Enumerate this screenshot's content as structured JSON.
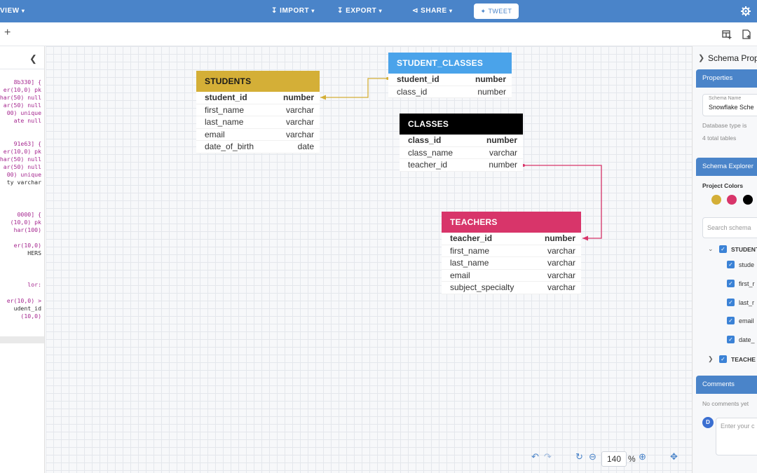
{
  "topbar": {
    "view_label": "VIEW",
    "import_label": "IMPORT",
    "export_label": "EXPORT",
    "share_label": "SHARE",
    "tweet_label": "TWEET",
    "accent": "#4a84c9"
  },
  "code_lines": [
    {
      "text": "8b330] {",
      "style": "pk"
    },
    {
      "text": "er(10,0) pk",
      "style": "pk"
    },
    {
      "text": "har(50) null",
      "style": "pk"
    },
    {
      "text": "ar(50) null",
      "style": "pk"
    },
    {
      "text": "00) unique",
      "style": "pk"
    },
    {
      "text": "ate null",
      "style": "pk"
    },
    {
      "text": "91e63] {",
      "style": "pk"
    },
    {
      "text": "er(10,0) pk",
      "style": "pk"
    },
    {
      "text": "har(50) null",
      "style": "pk"
    },
    {
      "text": "ar(50) null",
      "style": "pk"
    },
    {
      "text": "00) unique",
      "style": "pk"
    },
    {
      "text": "ty varchar",
      "style": "tx"
    },
    {
      "text": "0000] {",
      "style": "pk"
    },
    {
      "text": "(10,0) pk",
      "style": "pk"
    },
    {
      "text": "har(100)",
      "style": "pk"
    },
    {
      "text": "er(10,0)",
      "style": "pk"
    },
    {
      "text": "HERS",
      "style": "tx"
    },
    {
      "text": "lor:",
      "style": "pk"
    },
    {
      "text": "er(10,0) >",
      "style": "pk"
    },
    {
      "text": "udent_id",
      "style": "tx"
    },
    {
      "text": "(10,0)",
      "style": "pk"
    }
  ],
  "tables": {
    "students": {
      "name": "STUDENTS",
      "color": "#d4af37",
      "text_color": "#1a1a1a",
      "rows": [
        {
          "field": "student_id",
          "type": "number"
        },
        {
          "field": "first_name",
          "type": "varchar"
        },
        {
          "field": "last_name",
          "type": "varchar"
        },
        {
          "field": "email",
          "type": "varchar"
        },
        {
          "field": "date_of_birth",
          "type": "date"
        }
      ]
    },
    "student_classes": {
      "name": "STUDENT_CLASSES",
      "color": "#4aa3ea",
      "text_color": "#ffffff",
      "rows": [
        {
          "field": "student_id",
          "type": "number"
        },
        {
          "field": "class_id",
          "type": "number"
        }
      ]
    },
    "classes": {
      "name": "CLASSES",
      "color": "#000000",
      "text_color": "#ffffff",
      "rows": [
        {
          "field": "class_id",
          "type": "number"
        },
        {
          "field": "class_name",
          "type": "varchar"
        },
        {
          "field": "teacher_id",
          "type": "number"
        }
      ]
    },
    "teachers": {
      "name": "TEACHERS",
      "color": "#d8356a",
      "text_color": "#ffffff",
      "rows": [
        {
          "field": "teacher_id",
          "type": "number"
        },
        {
          "field": "first_name",
          "type": "varchar"
        },
        {
          "field": "last_name",
          "type": "varchar"
        },
        {
          "field": "email",
          "type": "varchar"
        },
        {
          "field": "subject_specialty",
          "type": "varchar"
        }
      ]
    }
  },
  "zoom": {
    "value": "140",
    "unit": "%"
  },
  "right_panel": {
    "title": "Schema Prop",
    "properties_label": "Properties",
    "schema_name_label": "Schema Name",
    "schema_name_value": "Snowflake Sche",
    "db_type_text": "Database type is",
    "total_tables_text": "4 total tables",
    "explorer_label": "Schema Explorer",
    "project_colors_label": "Project Colors",
    "colors": [
      "#d4af37",
      "#d8356a",
      "#000000"
    ],
    "search_placeholder": "Search schema",
    "tree": {
      "students": "STUDENT",
      "fields": [
        "stude",
        "first_r",
        "last_r",
        "email",
        "date_"
      ],
      "teachers": "TEACHE"
    },
    "comments_label": "Comments",
    "no_comments_text": "No comments yet",
    "avatar_letter": "D",
    "comment_placeholder": "Enter your c"
  }
}
